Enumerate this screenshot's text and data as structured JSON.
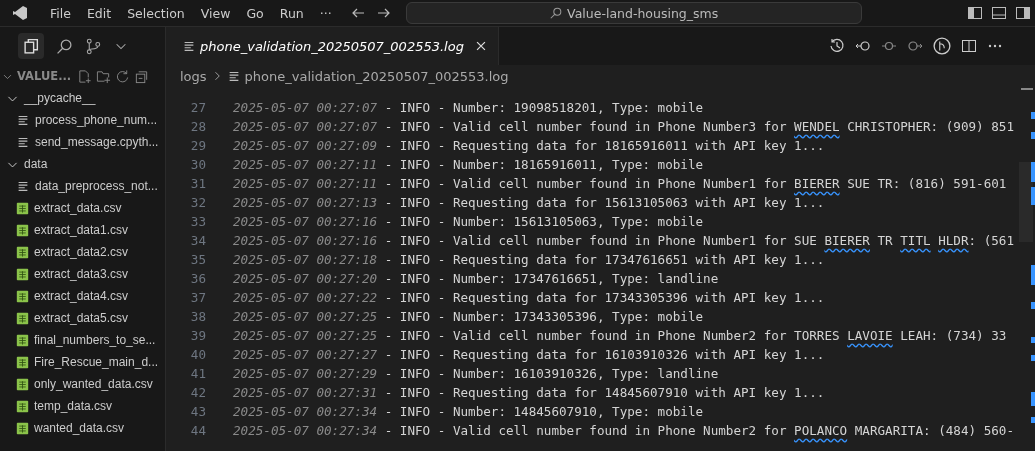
{
  "menu": [
    "File",
    "Edit",
    "Selection",
    "View",
    "Go",
    "Run",
    "···"
  ],
  "search": {
    "value": "Value-land-housing_sms"
  },
  "explorer": {
    "title": "VALUE...",
    "tree": [
      {
        "label": "__pycache__",
        "kind": "folder",
        "expanded": true,
        "children": [
          {
            "label": "process_phone_num...",
            "kind": "text"
          },
          {
            "label": "send_message.cpyth...",
            "kind": "text"
          }
        ]
      },
      {
        "label": "data",
        "kind": "folder",
        "expanded": true,
        "children": [
          {
            "label": "data_preprocess_not...",
            "kind": "text"
          },
          {
            "label": "extract_data.csv",
            "kind": "csv"
          },
          {
            "label": "extract_data1.csv",
            "kind": "csv"
          },
          {
            "label": "extract_data2.csv",
            "kind": "csv"
          },
          {
            "label": "extract_data3.csv",
            "kind": "csv"
          },
          {
            "label": "extract_data4.csv",
            "kind": "csv"
          },
          {
            "label": "extract_data5.csv",
            "kind": "csv"
          },
          {
            "label": "final_numbers_to_se...",
            "kind": "csv"
          },
          {
            "label": "Fire_Rescue_main_d...",
            "kind": "csv"
          },
          {
            "label": "only_wanted_data.csv",
            "kind": "csv"
          },
          {
            "label": "temp_data.csv",
            "kind": "csv"
          },
          {
            "label": "wanted_data.csv",
            "kind": "csv"
          }
        ]
      }
    ]
  },
  "tabs": [
    {
      "label": "phone_validation_20250507_002553.log",
      "selected": true,
      "preview": true
    }
  ],
  "breadcrumb": [
    "logs",
    "phone_validation_20250507_002553.log"
  ],
  "lines": [
    {
      "number": "27",
      "time": "2025-05-07 00:27:07",
      "message": [
        {
          "text": " - INFO - Number: 19098518201, Type: mobile"
        }
      ]
    },
    {
      "number": "28",
      "time": "2025-05-07 00:27:07",
      "message": [
        {
          "text": " - INFO - Valid cell number found in Phone Number3 for "
        },
        {
          "text": "WENDEL",
          "flagged": true
        },
        {
          "text": " CHRISTOPHER: (909) 851"
        }
      ]
    },
    {
      "number": "29",
      "time": "2025-05-07 00:27:09",
      "message": [
        {
          "text": " - INFO - Requesting data for 18165916011 with API key 1..."
        }
      ]
    },
    {
      "number": "30",
      "time": "2025-05-07 00:27:11",
      "message": [
        {
          "text": " - INFO - Number: 18165916011, Type: mobile"
        }
      ]
    },
    {
      "number": "31",
      "time": "2025-05-07 00:27:11",
      "message": [
        {
          "text": " - INFO - Valid cell number found in Phone Number1 for "
        },
        {
          "text": "BIERER",
          "flagged": true
        },
        {
          "text": " SUE TR: (816) 591-601"
        }
      ]
    },
    {
      "number": "32",
      "time": "2025-05-07 00:27:13",
      "message": [
        {
          "text": " - INFO - Requesting data for 15613105063 with API key 1..."
        }
      ]
    },
    {
      "number": "33",
      "time": "2025-05-07 00:27:16",
      "message": [
        {
          "text": " - INFO - Number: 15613105063, Type: mobile"
        }
      ]
    },
    {
      "number": "34",
      "time": "2025-05-07 00:27:16",
      "message": [
        {
          "text": " - INFO - Valid cell number found in Phone Number1 for SUE "
        },
        {
          "text": "BIERER",
          "flagged": true
        },
        {
          "text": " TR "
        },
        {
          "text": "TITL",
          "flagged": true,
          "gap_after": true
        },
        {
          "text": "HLDR",
          "flagged": true
        },
        {
          "text": ": (561"
        }
      ]
    },
    {
      "number": "35",
      "time": "2025-05-07 00:27:18",
      "message": [
        {
          "text": " - INFO - Requesting data for 17347616651 with API key 1..."
        }
      ]
    },
    {
      "number": "36",
      "time": "2025-05-07 00:27:20",
      "message": [
        {
          "text": " - INFO - Number: 17347616651, Type: landline"
        }
      ]
    },
    {
      "number": "37",
      "time": "2025-05-07 00:27:22",
      "message": [
        {
          "text": " - INFO - Requesting data for 17343305396 with API key 1..."
        }
      ]
    },
    {
      "number": "38",
      "time": "2025-05-07 00:27:25",
      "message": [
        {
          "text": " - INFO - Number: 17343305396, Type: mobile"
        }
      ]
    },
    {
      "number": "39",
      "time": "2025-05-07 00:27:25",
      "message": [
        {
          "text": " - INFO - Valid cell number found in Phone Number2 for TORRES "
        },
        {
          "text": "LAVOIE",
          "flagged": true
        },
        {
          "text": " LEAH: (734) 33"
        }
      ]
    },
    {
      "number": "40",
      "time": "2025-05-07 00:27:27",
      "message": [
        {
          "text": " - INFO - Requesting data for 16103910326 with API key 1..."
        }
      ]
    },
    {
      "number": "41",
      "time": "2025-05-07 00:27:29",
      "message": [
        {
          "text": " - INFO - Number: 16103910326, Type: landline"
        }
      ]
    },
    {
      "number": "42",
      "time": "2025-05-07 00:27:31",
      "message": [
        {
          "text": " - INFO - Requesting data for 14845607910 with API key 1..."
        }
      ]
    },
    {
      "number": "43",
      "time": "2025-05-07 00:27:34",
      "message": [
        {
          "text": " - INFO - Number: 14845607910, Type: mobile"
        }
      ]
    },
    {
      "number": "44",
      "time": "2025-05-07 00:27:34",
      "message": [
        {
          "text": " - INFO - Valid cell number found in Phone Number2 for "
        },
        {
          "text": "POLANCO",
          "flagged": true
        },
        {
          "text": " MARGARITA: (484) 560-"
        }
      ]
    }
  ]
}
